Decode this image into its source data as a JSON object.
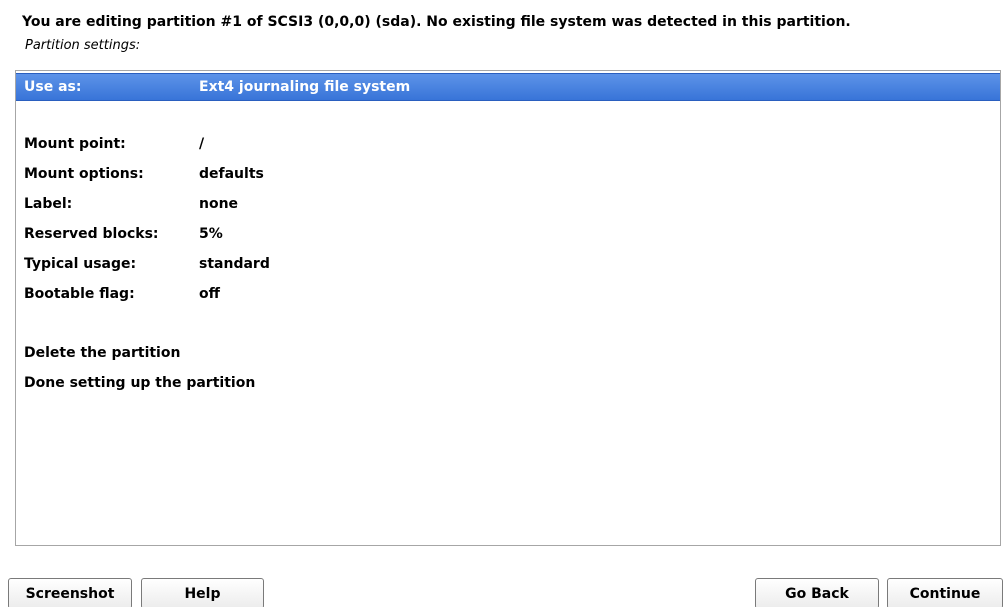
{
  "header": {
    "title": "You are editing partition #1 of SCSI3 (0,0,0) (sda). No existing file system was detected in this partition.",
    "subtitle": "Partition settings:"
  },
  "settings": {
    "use_as": {
      "label": "Use as:",
      "value": "Ext4 journaling file system",
      "selected": true
    },
    "mount_point": {
      "label": "Mount point:",
      "value": "/"
    },
    "mount_options": {
      "label": "Mount options:",
      "value": "defaults"
    },
    "label": {
      "label": "Label:",
      "value": "none"
    },
    "reserved_blocks": {
      "label": "Reserved blocks:",
      "value": "5%"
    },
    "typical_usage": {
      "label": "Typical usage:",
      "value": "standard"
    },
    "bootable_flag": {
      "label": "Bootable flag:",
      "value": "off"
    }
  },
  "actions": {
    "delete": "Delete the partition",
    "done": "Done setting up the partition"
  },
  "buttons": {
    "screenshot": "Screenshot",
    "help": "Help",
    "go_back": "Go Back",
    "continue": "Continue"
  },
  "colors": {
    "selection": "#3874d8",
    "selection_text": "#ffffff"
  }
}
